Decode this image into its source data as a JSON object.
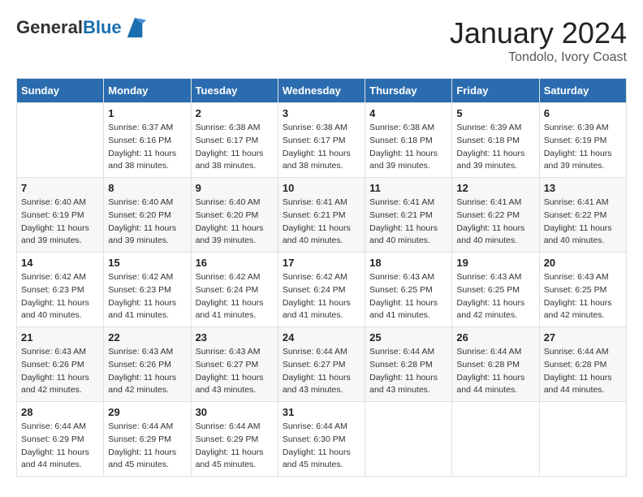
{
  "header": {
    "logo_general": "General",
    "logo_blue": "Blue",
    "month": "January 2024",
    "location": "Tondolo, Ivory Coast"
  },
  "weekdays": [
    "Sunday",
    "Monday",
    "Tuesday",
    "Wednesday",
    "Thursday",
    "Friday",
    "Saturday"
  ],
  "weeks": [
    [
      {
        "day": "",
        "info": ""
      },
      {
        "day": "1",
        "info": "Sunrise: 6:37 AM\nSunset: 6:16 PM\nDaylight: 11 hours\nand 38 minutes."
      },
      {
        "day": "2",
        "info": "Sunrise: 6:38 AM\nSunset: 6:17 PM\nDaylight: 11 hours\nand 38 minutes."
      },
      {
        "day": "3",
        "info": "Sunrise: 6:38 AM\nSunset: 6:17 PM\nDaylight: 11 hours\nand 38 minutes."
      },
      {
        "day": "4",
        "info": "Sunrise: 6:38 AM\nSunset: 6:18 PM\nDaylight: 11 hours\nand 39 minutes."
      },
      {
        "day": "5",
        "info": "Sunrise: 6:39 AM\nSunset: 6:18 PM\nDaylight: 11 hours\nand 39 minutes."
      },
      {
        "day": "6",
        "info": "Sunrise: 6:39 AM\nSunset: 6:19 PM\nDaylight: 11 hours\nand 39 minutes."
      }
    ],
    [
      {
        "day": "7",
        "info": "Sunrise: 6:40 AM\nSunset: 6:19 PM\nDaylight: 11 hours\nand 39 minutes."
      },
      {
        "day": "8",
        "info": "Sunrise: 6:40 AM\nSunset: 6:20 PM\nDaylight: 11 hours\nand 39 minutes."
      },
      {
        "day": "9",
        "info": "Sunrise: 6:40 AM\nSunset: 6:20 PM\nDaylight: 11 hours\nand 39 minutes."
      },
      {
        "day": "10",
        "info": "Sunrise: 6:41 AM\nSunset: 6:21 PM\nDaylight: 11 hours\nand 40 minutes."
      },
      {
        "day": "11",
        "info": "Sunrise: 6:41 AM\nSunset: 6:21 PM\nDaylight: 11 hours\nand 40 minutes."
      },
      {
        "day": "12",
        "info": "Sunrise: 6:41 AM\nSunset: 6:22 PM\nDaylight: 11 hours\nand 40 minutes."
      },
      {
        "day": "13",
        "info": "Sunrise: 6:41 AM\nSunset: 6:22 PM\nDaylight: 11 hours\nand 40 minutes."
      }
    ],
    [
      {
        "day": "14",
        "info": "Sunrise: 6:42 AM\nSunset: 6:23 PM\nDaylight: 11 hours\nand 40 minutes."
      },
      {
        "day": "15",
        "info": "Sunrise: 6:42 AM\nSunset: 6:23 PM\nDaylight: 11 hours\nand 41 minutes."
      },
      {
        "day": "16",
        "info": "Sunrise: 6:42 AM\nSunset: 6:24 PM\nDaylight: 11 hours\nand 41 minutes."
      },
      {
        "day": "17",
        "info": "Sunrise: 6:42 AM\nSunset: 6:24 PM\nDaylight: 11 hours\nand 41 minutes."
      },
      {
        "day": "18",
        "info": "Sunrise: 6:43 AM\nSunset: 6:25 PM\nDaylight: 11 hours\nand 41 minutes."
      },
      {
        "day": "19",
        "info": "Sunrise: 6:43 AM\nSunset: 6:25 PM\nDaylight: 11 hours\nand 42 minutes."
      },
      {
        "day": "20",
        "info": "Sunrise: 6:43 AM\nSunset: 6:25 PM\nDaylight: 11 hours\nand 42 minutes."
      }
    ],
    [
      {
        "day": "21",
        "info": "Sunrise: 6:43 AM\nSunset: 6:26 PM\nDaylight: 11 hours\nand 42 minutes."
      },
      {
        "day": "22",
        "info": "Sunrise: 6:43 AM\nSunset: 6:26 PM\nDaylight: 11 hours\nand 42 minutes."
      },
      {
        "day": "23",
        "info": "Sunrise: 6:43 AM\nSunset: 6:27 PM\nDaylight: 11 hours\nand 43 minutes."
      },
      {
        "day": "24",
        "info": "Sunrise: 6:44 AM\nSunset: 6:27 PM\nDaylight: 11 hours\nand 43 minutes."
      },
      {
        "day": "25",
        "info": "Sunrise: 6:44 AM\nSunset: 6:28 PM\nDaylight: 11 hours\nand 43 minutes."
      },
      {
        "day": "26",
        "info": "Sunrise: 6:44 AM\nSunset: 6:28 PM\nDaylight: 11 hours\nand 44 minutes."
      },
      {
        "day": "27",
        "info": "Sunrise: 6:44 AM\nSunset: 6:28 PM\nDaylight: 11 hours\nand 44 minutes."
      }
    ],
    [
      {
        "day": "28",
        "info": "Sunrise: 6:44 AM\nSunset: 6:29 PM\nDaylight: 11 hours\nand 44 minutes."
      },
      {
        "day": "29",
        "info": "Sunrise: 6:44 AM\nSunset: 6:29 PM\nDaylight: 11 hours\nand 45 minutes."
      },
      {
        "day": "30",
        "info": "Sunrise: 6:44 AM\nSunset: 6:29 PM\nDaylight: 11 hours\nand 45 minutes."
      },
      {
        "day": "31",
        "info": "Sunrise: 6:44 AM\nSunset: 6:30 PM\nDaylight: 11 hours\nand 45 minutes."
      },
      {
        "day": "",
        "info": ""
      },
      {
        "day": "",
        "info": ""
      },
      {
        "day": "",
        "info": ""
      }
    ]
  ]
}
